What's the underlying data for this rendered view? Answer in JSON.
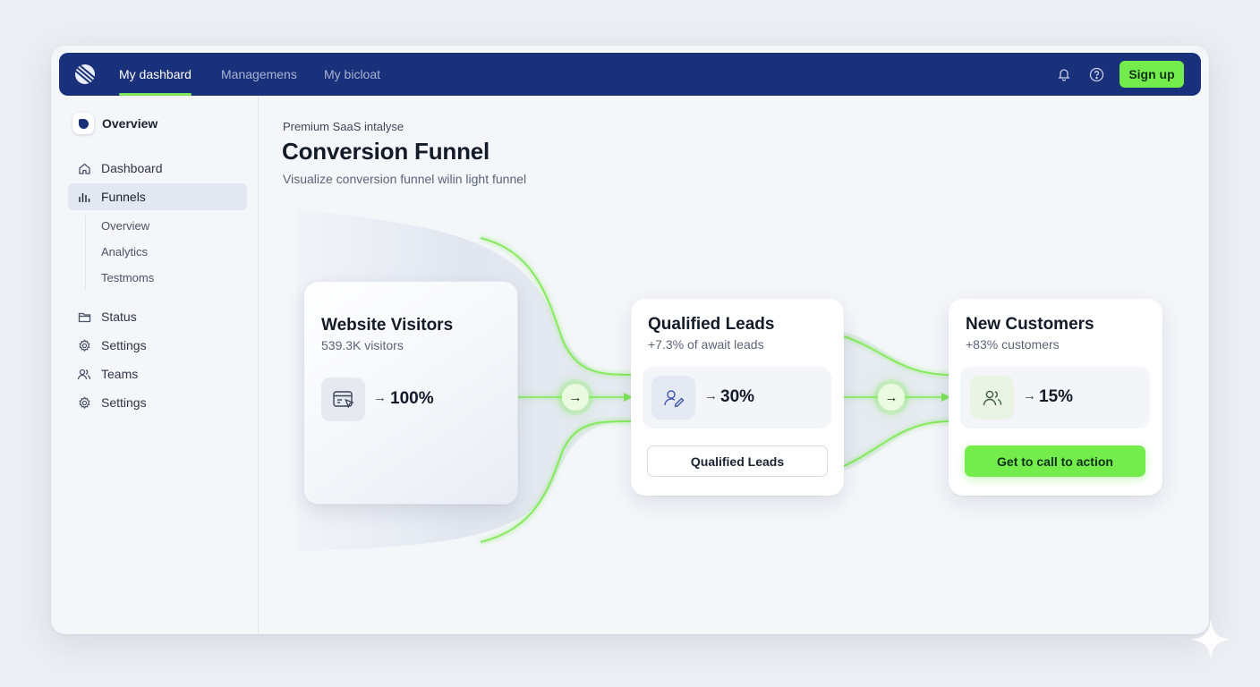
{
  "nav": {
    "tabs": [
      "My dashbard",
      "Managemens",
      "My bicloat"
    ],
    "active_tab": 0,
    "icons": [
      "logo-icon",
      "bell-icon",
      "help-icon"
    ],
    "signup_label": "Sign up"
  },
  "sidebar": {
    "overview_label": "Overview",
    "items": [
      {
        "label": "Dashboard",
        "icon": "home-icon"
      },
      {
        "label": "Funnels",
        "icon": "bar-chart-icon",
        "active": true
      },
      {
        "label": "Status",
        "icon": "folder-icon"
      },
      {
        "label": "Settings",
        "icon": "gear-icon"
      },
      {
        "label": "Teams",
        "icon": "users-icon"
      },
      {
        "label": "Settings",
        "icon": "gear-icon"
      }
    ],
    "sub_items": [
      "Overview",
      "Analytics",
      "Testmoms"
    ]
  },
  "page": {
    "eyebrow": "Premium SaaS intalyse",
    "title": "Conversion Funnel",
    "subtitle": "Visualize conversion funnel wilin light funnel"
  },
  "funnel": [
    {
      "title": "Website Visitors",
      "sub": "539.3K visitors",
      "arrow": "→",
      "value": "100%",
      "icon": "browser-cursor-icon"
    },
    {
      "title": "Qualified Leads",
      "sub": "+7.3% of await leads",
      "arrow": "→",
      "value": "30%",
      "icon": "user-edit-icon",
      "button": "Qualified Leads"
    },
    {
      "title": "New Customers",
      "sub": "+83% customers",
      "arrow": "→",
      "value": "15%",
      "icon": "users-icon",
      "button": "Get to call to action"
    }
  ],
  "flow_nodes": [
    "→",
    "→"
  ],
  "colors": {
    "nav_bg": "#19307a",
    "accent_green": "#74ed4c",
    "page_bg": "#f4f6fa"
  }
}
